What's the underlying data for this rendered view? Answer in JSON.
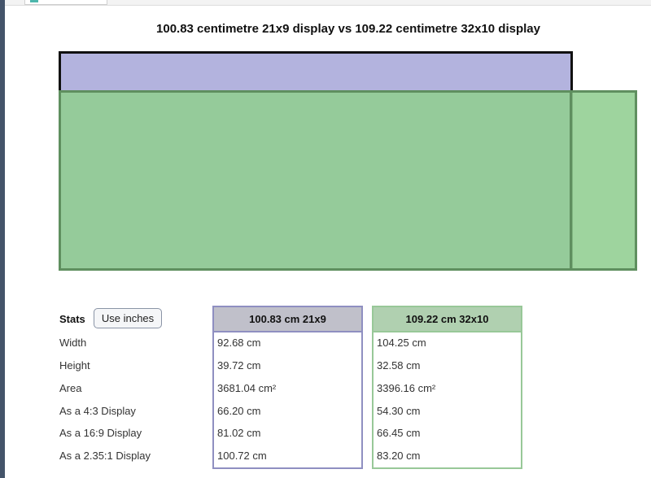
{
  "title": "100.83 centimetre 21x9 display vs 109.22 centimetre 32x10 display",
  "colors": {
    "display_a_fill": "#b3b3de",
    "display_a_border": "#111111",
    "display_b_fill": "#91ce91",
    "display_b_border": "#5f8f5f"
  },
  "stats": {
    "label": "Stats",
    "unit_button": "Use inches",
    "row_labels": [
      "Width",
      "Height",
      "Area",
      "As a 4:3 Display",
      "As a 16:9 Display",
      "As a 2.35:1 Display"
    ],
    "columns": [
      {
        "header": "100.83 cm 21x9",
        "values": [
          "92.68 cm",
          "39.72 cm",
          "3681.04 cm²",
          "66.20 cm",
          "81.02 cm",
          "100.72 cm"
        ]
      },
      {
        "header": "109.22 cm 32x10",
        "values": [
          "104.25 cm",
          "32.58 cm",
          "3396.16 cm²",
          "54.30 cm",
          "66.45 cm",
          "83.20 cm"
        ]
      }
    ]
  }
}
